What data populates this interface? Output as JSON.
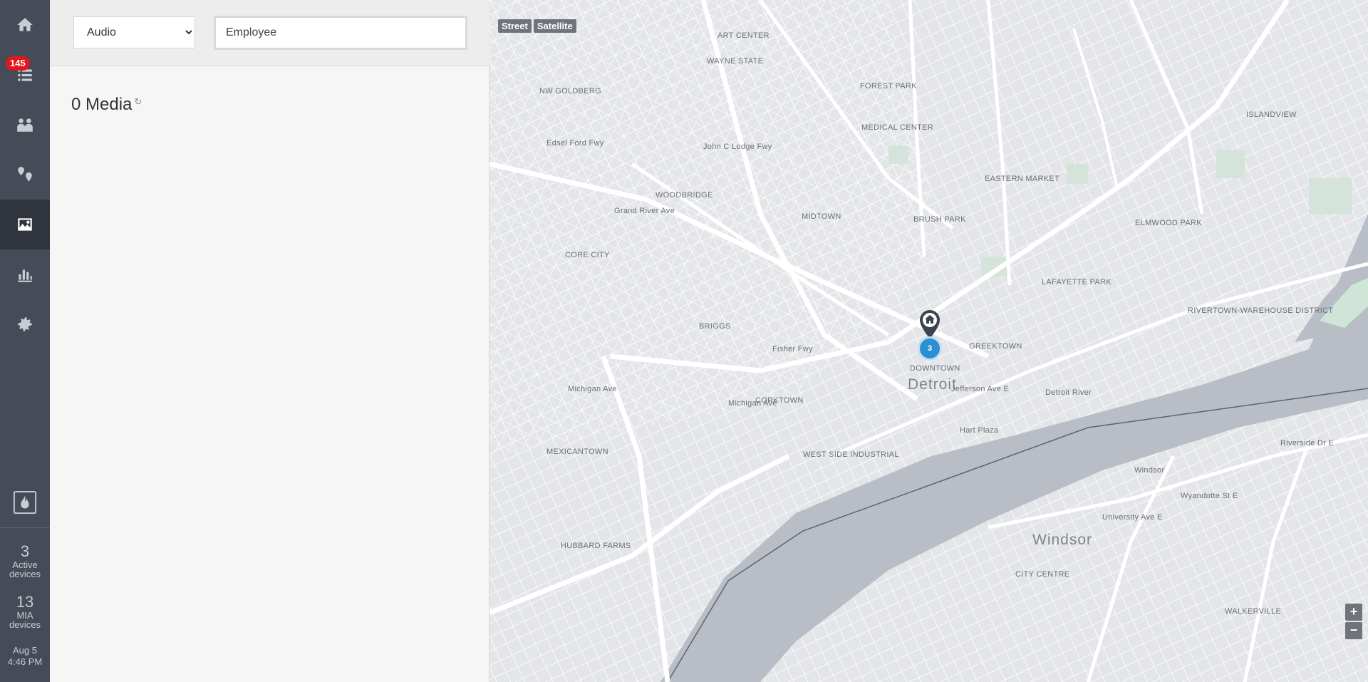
{
  "sidebar": {
    "items": [
      {
        "name": "home",
        "icon": "home-icon"
      },
      {
        "name": "list",
        "icon": "list-icon"
      },
      {
        "name": "people",
        "icon": "people-icon"
      },
      {
        "name": "locations",
        "icon": "location-icon"
      },
      {
        "name": "media",
        "icon": "image-icon",
        "active": true
      },
      {
        "name": "reports",
        "icon": "bar-chart-icon"
      },
      {
        "name": "settings",
        "icon": "gear-icon"
      }
    ],
    "badge": "145",
    "brand_icon": "fire-icon",
    "active_devices": {
      "count": "3",
      "label_line1": "Active",
      "label_line2": "devices"
    },
    "mia_devices": {
      "count": "13",
      "label_line1": "MIA",
      "label_line2": "devices"
    },
    "clock": {
      "date": "Aug 5",
      "time": "4:46 PM"
    }
  },
  "filters": {
    "type_selected": "Audio",
    "employee_placeholder": "Employee"
  },
  "media": {
    "title": "0 Media",
    "refresh_icon": "refresh-icon"
  },
  "map": {
    "street_label": "Street",
    "satellite_label": "Satellite",
    "zoom_in": "+",
    "zoom_out": "−",
    "cluster_count": "3",
    "pin_icon": "home-pin-icon",
    "labels": {
      "downtown": "DOWNTOWN",
      "detroit": "Detroit",
      "windsor": "Windsor",
      "greektown": "GREEKTOWN",
      "corktown": "CORKTOWN",
      "midtown": "MIDTOWN",
      "woodbridge": "WOODBRIDGE",
      "core_city": "CORE CITY",
      "briggs": "BRIGGS",
      "mexicantown": "MEXICANTOWN",
      "hubbard_farms": "HUBBARD FARMS",
      "eastern_market": "EASTERN MARKET",
      "lafayette_park": "LAFAYETTE PARK",
      "medical_center": "MEDICAL CENTER",
      "wayne_state": "WAYNE STATE",
      "art_center": "ART CENTER",
      "brush_park": "BRUSH PARK",
      "elmwood_park": "ELMWOOD PARK",
      "west_side_industrial": "WEST SIDE INDUSTRIAL",
      "rivertown": "RIVERTOWN-WAREHOUSE DISTRICT",
      "detroit_river": "Detroit River",
      "city_centre": "CITY CENTRE",
      "walkerville": "WALKERVILLE",
      "ng_goldberg": "NW GOLDBERG",
      "forest_park": "FOREST PARK",
      "islandview": "ISLANDVIEW",
      "fisher_fwy": "Fisher Fwy",
      "michigan_ave": "Michigan Ave",
      "jefferson_ave": "Jefferson Ave E",
      "john_c_lodge": "John C Lodge Fwy",
      "edsel_ford": "Edsel Ford Fwy",
      "grand_river": "Grand River Ave",
      "hart_plaza": "Hart Plaza",
      "windsor_small": "Windsor",
      "riverside_dr": "Riverside Dr E",
      "wyandotte": "Wyandotte St E",
      "university_ave": "University Ave E"
    }
  }
}
